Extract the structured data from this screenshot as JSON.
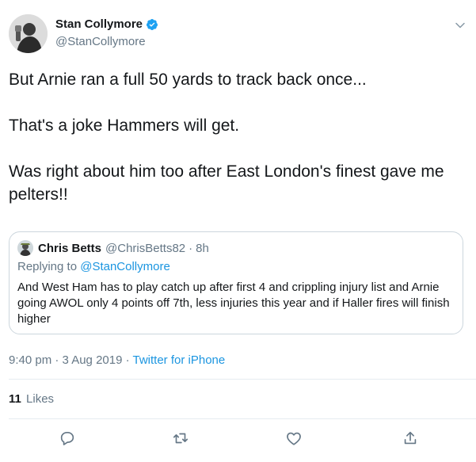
{
  "tweet": {
    "author": {
      "display_name": "Stan Collymore",
      "handle": "@StanCollymore",
      "verified": true
    },
    "text_lines": [
      "But Arnie ran a full 50 yards to track back once...",
      "That's a joke Hammers will get.",
      "Was right about him too after East London's finest gave me pelters!!"
    ],
    "quoted": {
      "display_name": "Chris Betts",
      "handle": "@ChrisBetts82",
      "dot": "·",
      "time": "8h",
      "replying_prefix": "Replying to ",
      "replying_to": "@StanCollymore",
      "text": "And West Ham has to play catch up after first 4 and crippling injury list and Arnie going AWOL only 4 points off 7th, less injuries this year and if Haller fires will finish higher"
    },
    "meta": {
      "timestamp": "9:40 pm · 3 Aug 2019",
      "separator": " · ",
      "source": "Twitter for iPhone"
    },
    "stats": {
      "likes_count": "11",
      "likes_label": "Likes"
    },
    "actions": [
      "reply-icon",
      "retweet-icon",
      "like-icon",
      "share-icon"
    ],
    "colors": {
      "accent": "#1da1f2",
      "link": "#1b95e0",
      "secondary_text": "#657786",
      "border": "#ccd6dd"
    }
  }
}
